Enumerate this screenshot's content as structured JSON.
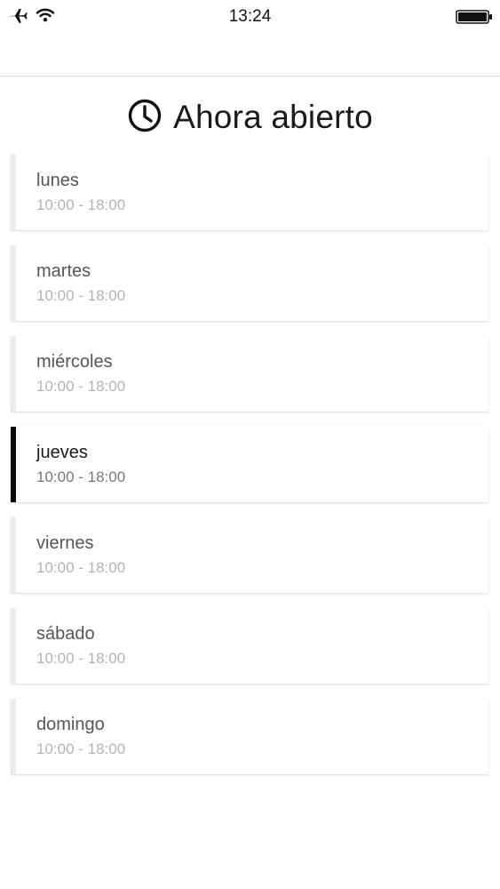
{
  "status_bar": {
    "time": "13:24",
    "icons": [
      "airplane-icon",
      "wifi-icon",
      "battery-icon"
    ]
  },
  "header": {
    "icon": "clock-icon",
    "title": "Ahora abierto"
  },
  "days": [
    {
      "name": "lunes",
      "hours": "10:00 - 18:00",
      "active": false
    },
    {
      "name": "martes",
      "hours": "10:00 - 18:00",
      "active": false
    },
    {
      "name": "miércoles",
      "hours": "10:00 - 18:00",
      "active": false
    },
    {
      "name": "jueves",
      "hours": "10:00 - 18:00",
      "active": true
    },
    {
      "name": "viernes",
      "hours": "10:00 - 18:00",
      "active": false
    },
    {
      "name": "sábado",
      "hours": "10:00 - 18:00",
      "active": false
    },
    {
      "name": "domingo",
      "hours": "10:00 - 18:00",
      "active": false
    }
  ],
  "colors": {
    "active_marker": "#0a0a0a",
    "inactive_marker": "#ececec",
    "hours_text": "#b3b3b3"
  }
}
